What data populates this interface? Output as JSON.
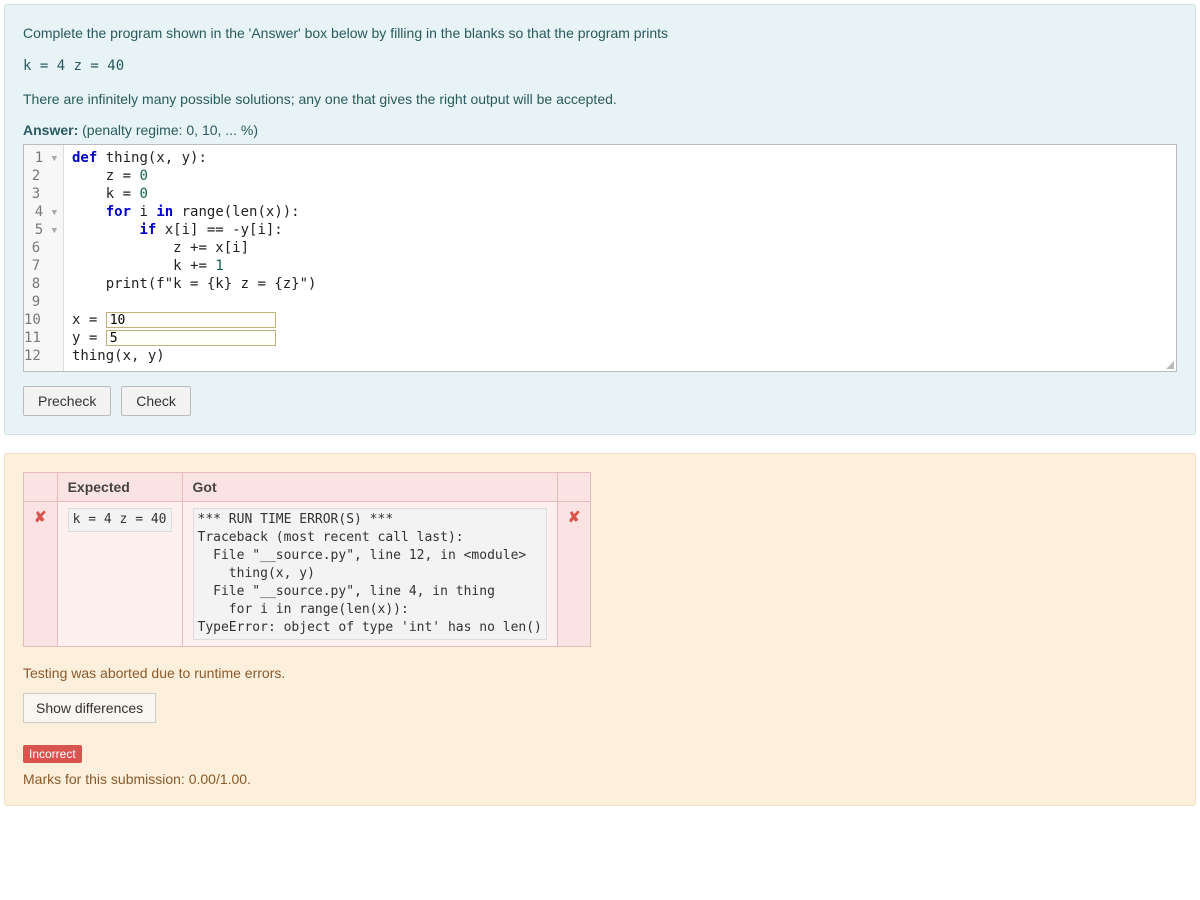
{
  "question": {
    "intro1": "Complete the program shown in the 'Answer' box below by filling in the blanks so that the program prints",
    "target_output": "k = 4 z = 40",
    "intro2": "There are infinitely many possible solutions; any one that gives the right output will be accepted.",
    "answer_label": "Answer:",
    "penalty": "(penalty regime: 0, 10, ... %)"
  },
  "code": {
    "lines": [
      {
        "n": "1",
        "fold": true
      },
      {
        "n": "2"
      },
      {
        "n": "3"
      },
      {
        "n": "4",
        "fold": true
      },
      {
        "n": "5",
        "fold": true
      },
      {
        "n": "6"
      },
      {
        "n": "7"
      },
      {
        "n": "8"
      },
      {
        "n": "9"
      },
      {
        "n": "10"
      },
      {
        "n": "11"
      },
      {
        "n": "12"
      }
    ],
    "src": {
      "l1_kw1": "def",
      "l1_name": "thing",
      "l1_params": "(x, y):",
      "l2_var": "z = ",
      "l2_num": "0",
      "l3_var": "k = ",
      "l3_num": "0",
      "l4_kw": "for",
      "l4_rest": " i ",
      "l4_kw2": "in",
      "l4_call": " range(len(x)):",
      "l5_kw": "if",
      "l5_rest": " x[i] == -y[i]:",
      "l6_body": "z += x[i]",
      "l7_body": "k += ",
      "l7_num": "1",
      "l8_call": "print",
      "l8_arg": "(f\"k = {k} z = {z}\")",
      "l10_pre": "x = ",
      "l10_val": "10",
      "l11_pre": "y = ",
      "l11_val": "5",
      "l12": "thing(x, y)"
    }
  },
  "buttons": {
    "precheck": "Precheck",
    "check": "Check"
  },
  "results": {
    "headers": {
      "expected": "Expected",
      "got": "Got"
    },
    "row": {
      "expected": "k = 4 z = 40",
      "got": "*** RUN TIME ERROR(S) ***\nTraceback (most recent call last):\n  File \"__source.py\", line 12, in <module>\n    thing(x, y)\n  File \"__source.py\", line 4, in thing\n    for i in range(len(x)):\nTypeError: object of type 'int' has no len()"
    },
    "abort": "Testing was aborted due to runtime errors.",
    "showdiff": "Show differences",
    "incorrect": "Incorrect",
    "marks": "Marks for this submission: 0.00/1.00."
  },
  "chart_data": {
    "type": "table",
    "title": "Test results",
    "columns": [
      "Expected",
      "Got"
    ],
    "rows": [
      {
        "pass": false,
        "expected": "k = 4 z = 40",
        "got": "*** RUN TIME ERROR(S) ***\nTraceback (most recent call last):\n  File \"__source.py\", line 12, in <module>\n    thing(x, y)\n  File \"__source.py\", line 4, in thing\n    for i in range(len(x)):\nTypeError: object of type 'int' has no len()"
      }
    ]
  }
}
